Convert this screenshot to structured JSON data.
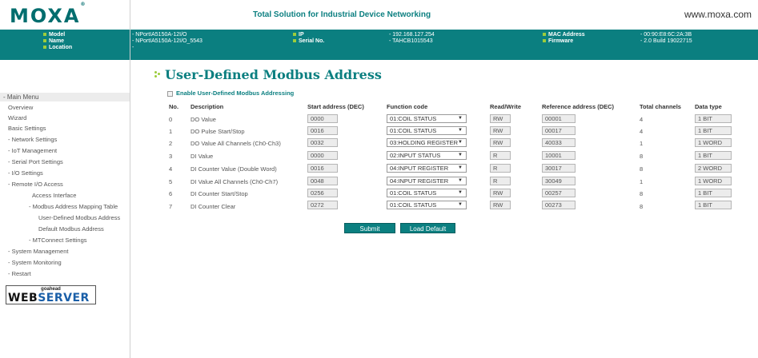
{
  "header": {
    "logo": "MOXA",
    "logo_mark": "®",
    "tagline": "Total Solution for Industrial Device Networking",
    "site": "www.moxa.com"
  },
  "info": {
    "model_label": "Model",
    "model_value": "- NPortIA5150A-12I/O",
    "name_label": "Name",
    "name_value": "- NPortIA5150A-12I/O_5543",
    "location_label": "Location",
    "location_value": "-",
    "ip_label": "IP",
    "ip_value": "- 192.168.127.254",
    "serial_label": "Serial No.",
    "serial_value": "- TAHCB1015543",
    "mac_label": "MAC Address",
    "mac_value": "- 00:90:E8:6C:2A:3B",
    "firmware_label": "Firmware",
    "firmware_value": "- 2.0 Build 19022715"
  },
  "sidebar": {
    "head": "- Main Menu",
    "items": [
      "Overview",
      "Wizard",
      "Basic Settings",
      "- Network Settings",
      "- IoT Management",
      "- Serial Port Settings",
      "- I/O Settings",
      "- Remote I/O Access",
      "Access Interface",
      "- Modbus Address Mapping Table",
      "User-Defined Modbus Address",
      "Default Modbus Address",
      "- MTConnect Settings",
      "- System Management",
      "- System Monitoring",
      "- Restart"
    ],
    "badge_top": "goahead",
    "badge_a": "WEB",
    "badge_b": "SERVER"
  },
  "page": {
    "title": "User-Defined Modbus Address",
    "enable_label": "Enable User-Defined Modbus Addressing"
  },
  "table": {
    "headers": [
      "No.",
      "Description",
      "Start address (DEC)",
      "Function code",
      "Read/Write",
      "Reference address (DEC)",
      "Total channels",
      "Data type"
    ],
    "rows": [
      {
        "no": "0",
        "desc": "DO Value",
        "start": "0000",
        "func": "01:COIL STATUS",
        "rw": "RW",
        "ref": "00001",
        "total": "4",
        "type": "1 BIT"
      },
      {
        "no": "1",
        "desc": "DO Pulse Start/Stop",
        "start": "0016",
        "func": "01:COIL STATUS",
        "rw": "RW",
        "ref": "00017",
        "total": "4",
        "type": "1 BIT"
      },
      {
        "no": "2",
        "desc": "DO Value All Channels (Ch0-Ch3)",
        "start": "0032",
        "func": "03:HOLDING REGISTER",
        "rw": "RW",
        "ref": "40033",
        "total": "1",
        "type": "1 WORD"
      },
      {
        "no": "3",
        "desc": "DI Value",
        "start": "0000",
        "func": "02:INPUT STATUS",
        "rw": "R",
        "ref": "10001",
        "total": "8",
        "type": "1 BIT"
      },
      {
        "no": "4",
        "desc": "DI Counter Value (Double Word)",
        "start": "0016",
        "func": "04:INPUT REGISTER",
        "rw": "R",
        "ref": "30017",
        "total": "8",
        "type": "2 WORD"
      },
      {
        "no": "5",
        "desc": "DI Value All Channels (Ch0-Ch7)",
        "start": "0048",
        "func": "04:INPUT REGISTER",
        "rw": "R",
        "ref": "30049",
        "total": "1",
        "type": "1 WORD"
      },
      {
        "no": "6",
        "desc": "DI Counter Start/Stop",
        "start": "0256",
        "func": "01:COIL STATUS",
        "rw": "RW",
        "ref": "00257",
        "total": "8",
        "type": "1 BIT"
      },
      {
        "no": "7",
        "desc": "DI Counter Clear",
        "start": "0272",
        "func": "01:COIL STATUS",
        "rw": "RW",
        "ref": "00273",
        "total": "8",
        "type": "1 BIT"
      }
    ]
  },
  "buttons": {
    "submit": "Submit",
    "load_default": "Load Default"
  },
  "colors": {
    "brand_teal": "#0b7f80",
    "bullet_green": "#9ccc3b"
  }
}
